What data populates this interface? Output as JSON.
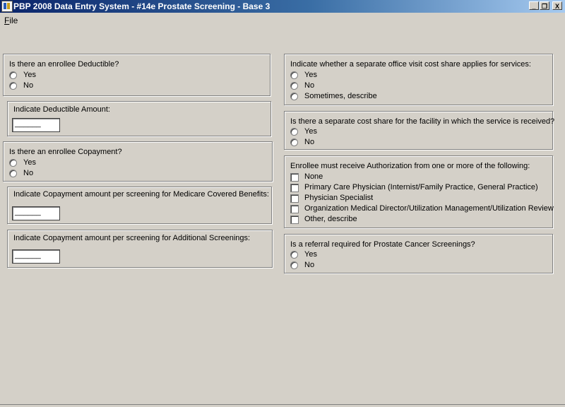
{
  "window": {
    "title": "PBP 2008 Data Entry System - #14e Prostate Screening - Base 3",
    "minimize": "_",
    "restore": "❐",
    "close": "X"
  },
  "menu": {
    "file_accel": "F",
    "file_rest": "ile"
  },
  "left": {
    "deductible": {
      "question": "Is there an enrollee Deductible?",
      "options": [
        "Yes",
        "No"
      ]
    },
    "deductible_amount": {
      "label": "Indicate Deductible Amount:",
      "value": "______"
    },
    "copayment": {
      "question": "Is there an enrollee Copayment?",
      "options": [
        "Yes",
        "No"
      ]
    },
    "copay_medicare": {
      "label": "Indicate Copayment amount per screening for Medicare Covered Benefits:",
      "value": "______"
    },
    "copay_additional": {
      "label": "Indicate Copayment amount per screening for Additional Screenings:",
      "value": "______"
    }
  },
  "right": {
    "office_visit": {
      "question": "Indicate whether a separate office visit cost share applies for services:",
      "options": [
        "Yes",
        "No",
        "Sometimes, describe"
      ]
    },
    "facility": {
      "question": "Is there a separate cost share for the facility in which the service is received?",
      "options": [
        "Yes",
        "No"
      ]
    },
    "authorization": {
      "question": "Enrollee must receive Authorization from one or more of the following:",
      "options": [
        "None",
        "Primary Care Physician (Internist/Family Practice, General Practice)",
        "Physician Specialist",
        "Organization Medical Director/Utilization Management/Utilization Review",
        "Other, describe"
      ]
    },
    "referral": {
      "question": "Is a referral required for Prostate Cancer Screenings?",
      "options": [
        "Yes",
        "No"
      ]
    }
  }
}
